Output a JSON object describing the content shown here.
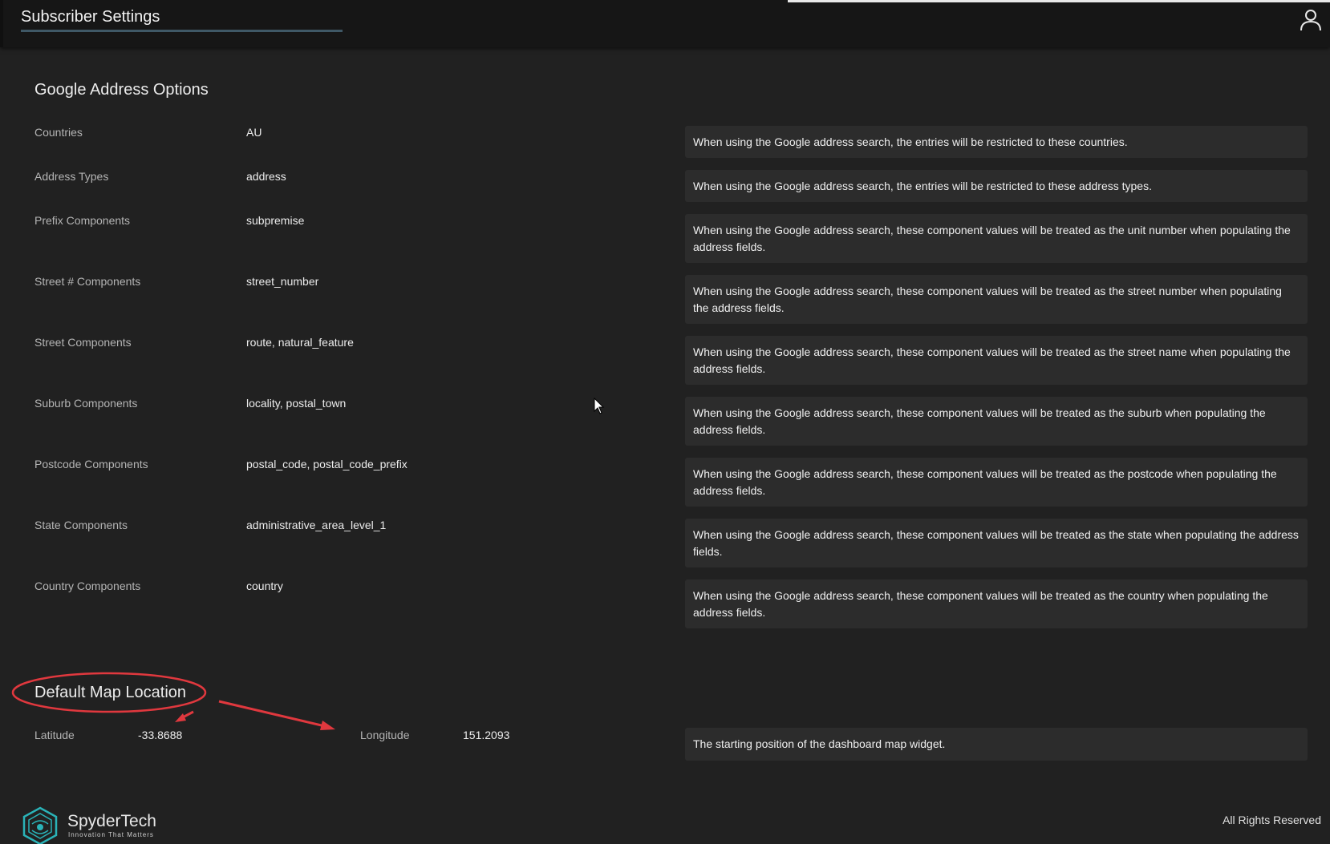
{
  "header": {
    "title": "Subscriber Settings",
    "user_icon": "user-icon"
  },
  "google_address": {
    "title": "Google Address Options",
    "rows": [
      {
        "label": "Countries",
        "value": "AU",
        "help": "When using the Google address search, the entries will be restricted to these countries."
      },
      {
        "label": "Address Types",
        "value": "address",
        "help": "When using the Google address search, the entries will be restricted to these address types."
      },
      {
        "label": "Prefix Components",
        "value": "subpremise",
        "help": "When using the Google address search, these component values will be treated as the unit number when populating the address fields."
      },
      {
        "label": "Street # Components",
        "value": "street_number",
        "help": "When using the Google address search, these component values will be treated as the street number when populating the address fields."
      },
      {
        "label": "Street Components",
        "value": "route, natural_feature",
        "help": "When using the Google address search, these component values will be treated as the street name when populating the address fields."
      },
      {
        "label": "Suburb Components",
        "value": "locality, postal_town",
        "help": "When using the Google address search, these component values will be treated as the suburb when populating the address fields."
      },
      {
        "label": "Postcode Components",
        "value": "postal_code, postal_code_prefix",
        "help": "When using the Google address search, these component values will be treated as the postcode when populating the address fields."
      },
      {
        "label": "State Components",
        "value": "administrative_area_level_1",
        "help": "When using the Google address search, these component values will be treated as the state when populating the address fields."
      },
      {
        "label": "Country Components",
        "value": "country",
        "help": "When using the Google address search, these component values will be treated as the country when populating the address fields."
      }
    ]
  },
  "map_location": {
    "title": "Default Map Location",
    "latitude_label": "Latitude",
    "latitude_value": "-33.8688",
    "longitude_label": "Longitude",
    "longitude_value": "151.2093",
    "help": "The starting position of the dashboard map widget."
  },
  "footer": {
    "brand_name": "SpyderTech",
    "brand_tagline": "Innovation That Matters",
    "rights": "All Rights Reserved"
  },
  "colors": {
    "background": "#212121",
    "topbar": "#161616",
    "help_box": "#2c2c2c",
    "annotation_red": "#e0383e",
    "logo_teal": "#2ab3b8"
  }
}
